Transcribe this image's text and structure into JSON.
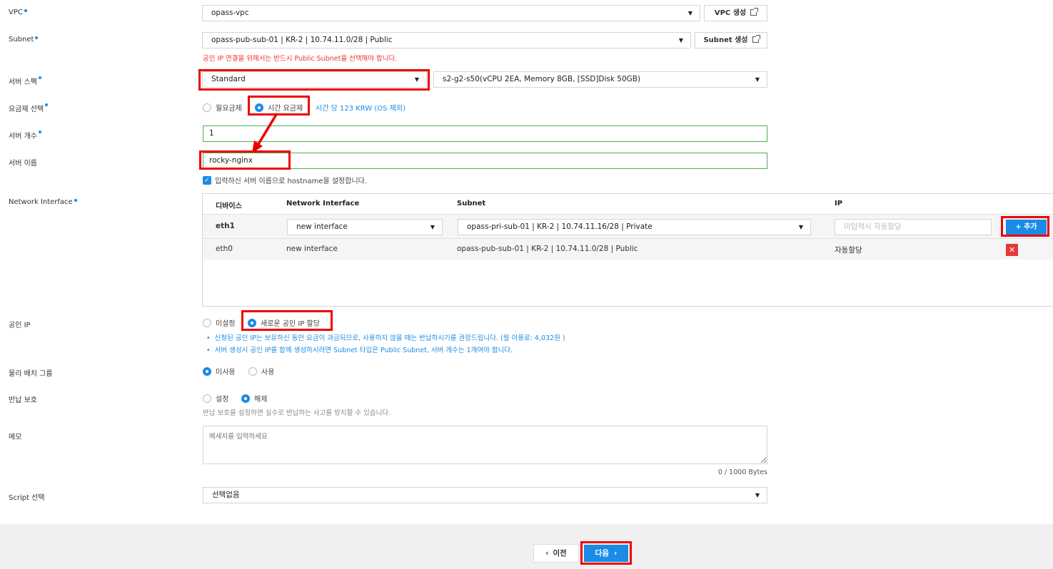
{
  "vpc": {
    "label": "VPC",
    "value": "opass-vpc",
    "create_button": "VPC 생성"
  },
  "subnet": {
    "label": "Subnet",
    "value": "opass-pub-sub-01 | KR-2 | 10.74.11.0/28 | Public",
    "create_button": "Subnet 생성",
    "warning": "공인 IP 연결을 위해서는 반드시 Public Subnet을 선택해야 합니다."
  },
  "server_spec": {
    "label": "서버 스펙",
    "type": "Standard",
    "spec": "s2-g2-s50(vCPU 2EA, Memory 8GB, [SSD]Disk 50GB)"
  },
  "billing": {
    "label": "요금제 선택",
    "options": [
      "월요금제",
      "시간 요금제"
    ],
    "selected": "시간 요금제",
    "price_note": "시간 당 123 KRW (OS 제외)"
  },
  "server_count": {
    "label": "서버 개수",
    "value": "1"
  },
  "server_name": {
    "label": "서버 이름",
    "value": "rocky-nginx",
    "hostname_checkbox": "입력하신 서버 이름으로 hostname을 설정합니다."
  },
  "network_interface": {
    "label": "Network Interface",
    "columns": [
      "디바이스",
      "Network Interface",
      "Subnet",
      "IP"
    ],
    "edit_row": {
      "device": "eth1",
      "interface": "new interface",
      "subnet": "opass-pri-sub-01 | KR-2 | 10.74.11.16/28 | Private",
      "ip_placeholder": "미입력시 자동할당",
      "add_button": "+ 추가"
    },
    "rows": [
      {
        "device": "eth0",
        "interface": "new interface",
        "subnet": "opass-pub-sub-01 | KR-2 | 10.74.11.0/28 | Public",
        "ip": "자동할당"
      }
    ]
  },
  "public_ip": {
    "label": "공인 IP",
    "options": [
      "미설정",
      "새로운 공인 IP 할당"
    ],
    "selected": "새로운 공인 IP 할당",
    "notes": [
      "신청된 공인 IP는 보유하신 동안 요금이 과금되므로, 사용하지 않을 때는 반납하시기를 권장드립니다. (월 이용료: 4,032원 )",
      "서버 생성시 공인 IP를 함께 생성하시려면 Subnet 타입은 Public Subnet, 서버 개수는 1개여야 합니다."
    ]
  },
  "placement_group": {
    "label": "물리 배치 그룹",
    "options": [
      "미사용",
      "사용"
    ],
    "selected": "미사용"
  },
  "return_protection": {
    "label": "반납 보호",
    "options": [
      "설정",
      "해제"
    ],
    "selected": "해제",
    "note": "반납 보호를 설정하면 실수로 반납하는 사고를 방지할 수 있습니다."
  },
  "memo": {
    "label": "메모",
    "placeholder": "메세지를 입력하세요",
    "counter": "0 / 1000 Bytes"
  },
  "script": {
    "label": "Script 선택",
    "value": "선택없음"
  },
  "footer": {
    "prev_button": "이전",
    "next_button": "다음"
  },
  "colors": {
    "accent": "#1a8ce6",
    "highlight": "#e00000",
    "delete": "#e53935"
  }
}
